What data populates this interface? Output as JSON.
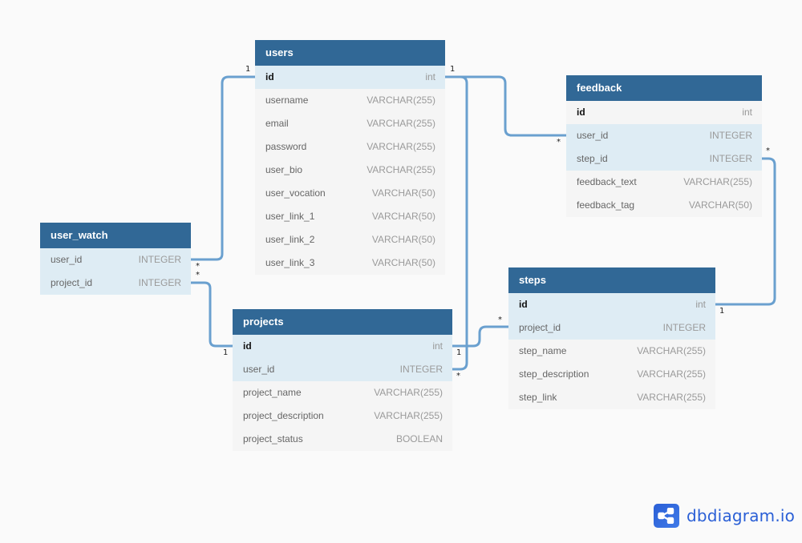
{
  "colors": {
    "header": "#316896",
    "link": "#6aa0cf",
    "highlight_row": "#deecf4",
    "body_row": "#f5f5f5",
    "brand": "#2a5fd6"
  },
  "tables": {
    "users": {
      "name": "users",
      "fields": [
        {
          "name": "id",
          "type": "int"
        },
        {
          "name": "username",
          "type": "VARCHAR(255)"
        },
        {
          "name": "email",
          "type": "VARCHAR(255)"
        },
        {
          "name": "password",
          "type": "VARCHAR(255)"
        },
        {
          "name": "user_bio",
          "type": "VARCHAR(255)"
        },
        {
          "name": "user_vocation",
          "type": "VARCHAR(50)"
        },
        {
          "name": "user_link_1",
          "type": "VARCHAR(50)"
        },
        {
          "name": "user_link_2",
          "type": "VARCHAR(50)"
        },
        {
          "name": "user_link_3",
          "type": "VARCHAR(50)"
        }
      ]
    },
    "feedback": {
      "name": "feedback",
      "fields": [
        {
          "name": "id",
          "type": "int"
        },
        {
          "name": "user_id",
          "type": "INTEGER"
        },
        {
          "name": "step_id",
          "type": "INTEGER"
        },
        {
          "name": "feedback_text",
          "type": "VARCHAR(255)"
        },
        {
          "name": "feedback_tag",
          "type": "VARCHAR(50)"
        }
      ]
    },
    "user_watch": {
      "name": "user_watch",
      "fields": [
        {
          "name": "user_id",
          "type": "INTEGER"
        },
        {
          "name": "project_id",
          "type": "INTEGER"
        }
      ]
    },
    "projects": {
      "name": "projects",
      "fields": [
        {
          "name": "id",
          "type": "int"
        },
        {
          "name": "user_id",
          "type": "INTEGER"
        },
        {
          "name": "project_name",
          "type": "VARCHAR(255)"
        },
        {
          "name": "project_description",
          "type": "VARCHAR(255)"
        },
        {
          "name": "project_status",
          "type": "BOOLEAN"
        }
      ]
    },
    "steps": {
      "name": "steps",
      "fields": [
        {
          "name": "id",
          "type": "int"
        },
        {
          "name": "project_id",
          "type": "INTEGER"
        },
        {
          "name": "step_name",
          "type": "VARCHAR(255)"
        },
        {
          "name": "step_description",
          "type": "VARCHAR(255)"
        },
        {
          "name": "step_link",
          "type": "VARCHAR(255)"
        }
      ]
    }
  },
  "relationships": [
    {
      "from": "user_watch.user_id",
      "to": "users.id",
      "from_card": "*",
      "to_card": "1"
    },
    {
      "from": "user_watch.project_id",
      "to": "projects.id",
      "from_card": "*",
      "to_card": "1"
    },
    {
      "from": "feedback.user_id",
      "to": "users.id",
      "from_card": "*",
      "to_card": "1"
    },
    {
      "from": "projects.user_id",
      "to": "users.id",
      "from_card": "*",
      "to_card": "1"
    },
    {
      "from": "steps.project_id",
      "to": "projects.id",
      "from_card": "*",
      "to_card": "1"
    },
    {
      "from": "feedback.step_id",
      "to": "steps.id",
      "from_card": "*",
      "to_card": "1"
    }
  ],
  "cardinality_labels": {
    "one": "1",
    "many": "*"
  },
  "brand": {
    "name": "dbdiagram.io",
    "icon": "share-icon"
  }
}
